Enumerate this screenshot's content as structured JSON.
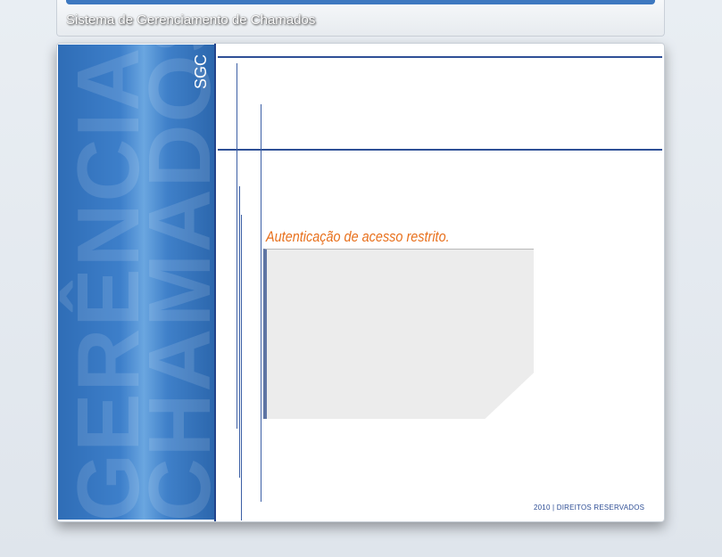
{
  "header": {
    "title": "Sistema de Gerenciamento de Chamados"
  },
  "side": {
    "abbr": "SGC",
    "decor": [
      "GERÊNCIA",
      "CHAMADOS"
    ]
  },
  "auth": {
    "title": "Autenticação de acesso restrito."
  },
  "footer": {
    "copyright": "2010 | DIREITOS RESERVADOS"
  },
  "colors": {
    "accent_blue": "#3d78c0",
    "orange": "#e8701c",
    "line_blue": "#2e4f96"
  }
}
